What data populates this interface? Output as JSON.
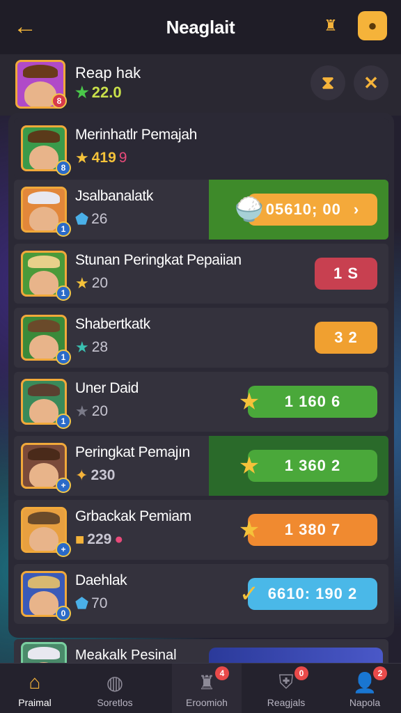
{
  "header": {
    "title": "Neaglait",
    "back_icon": "back-arrow-icon",
    "house_icon": "house-icon",
    "coin_icon": "coin-icon"
  },
  "profile": {
    "name": "Reap hak",
    "score": "22.0",
    "badge": "8",
    "action_1_icon": "hourglass-icon",
    "action_2_icon": "close-icon"
  },
  "rows": [
    {
      "name": "Merinhatlr Pemajah",
      "score": "419",
      "extra": "9",
      "rank": "8",
      "avatar_color": "#3a9a4a",
      "hair_color": "#5a3a1a",
      "star_color": "#f5c23a",
      "star": "★"
    },
    {
      "name": "Jsalbanalatk",
      "score": "26",
      "rank": "1",
      "avatar_color": "#e2873a",
      "hair_color": "#e8e8f0",
      "star_color": "#4ab0e8",
      "star": "⬟",
      "pill": "05610; 00",
      "pill_suffix": "›",
      "pill_color": "#f4a93a",
      "highlight": "#3e8a2a",
      "pill_icon": "🍚"
    },
    {
      "name": "Stunan Peringkat Pepaiian",
      "score": "20",
      "rank": "1",
      "avatar_color": "#4a9a3a",
      "hair_color": "#e8d08a",
      "star_color": "#f5c23a",
      "star": "★",
      "pill": "1 S",
      "pill_color": "#c84050"
    },
    {
      "name": "Shabertkatk",
      "score": "28",
      "rank": "1",
      "avatar_color": "#3a8a3a",
      "hair_color": "#6a4a2a",
      "star_color": "#3ac0b0",
      "star": "★",
      "pill": "3 2",
      "pill_color": "#f0a030"
    },
    {
      "name": "Uner Daid",
      "score": "20",
      "rank": "1",
      "avatar_color": "#3a8a5a",
      "hair_color": "#5a4030",
      "star_color": "#7a7a88",
      "star": "★",
      "pill": "1    160 6",
      "pill_color": "#4aa83a",
      "pill_icon": "★"
    },
    {
      "name": "Peringkat Pemajın",
      "score": "230",
      "rank": "+",
      "avatar_color": "#7a4a3a",
      "hair_color": "#4a2a1a",
      "star_color": "#f5b33a",
      "star": "✦",
      "pill": "1    360 2",
      "pill_color": "#4aa83a",
      "highlight": "#2a6a2a",
      "pill_icon": "★"
    },
    {
      "name": "Grbackak Pemiam",
      "score": "229",
      "extra": "●",
      "rank": "+",
      "avatar_color": "#e8a040",
      "hair_color": "#6a4a2a",
      "star_color": "#f5b33a",
      "star": "■",
      "pill": "1 380 7",
      "pill_color": "#f08a30",
      "pill_icon": "★"
    },
    {
      "name": "Daehlak",
      "score": "70",
      "rank": "0",
      "avatar_color": "#3a5ab8",
      "hair_color": "#d8b870",
      "star_color": "#4ab0e8",
      "star": "⬟",
      "pill": "6610: 190 2",
      "pill_color": "#4ab8e8",
      "pill_icon": "✓"
    }
  ],
  "partial_row": {
    "name": "Meakalk Pesinal"
  },
  "tabs": [
    {
      "label": "Praimal",
      "icon": "house-icon",
      "glyph": "⌂",
      "active": true
    },
    {
      "label": "Soretlos",
      "icon": "compass-icon",
      "glyph": "◍"
    },
    {
      "label": "Eroomioh",
      "icon": "castle-icon",
      "glyph": "♜",
      "badge": "4"
    },
    {
      "label": "Reagjals",
      "icon": "shield-icon",
      "glyph": "⛨",
      "badge": "0"
    },
    {
      "label": "Napola",
      "icon": "person-icon",
      "glyph": "👤",
      "badge": "2"
    }
  ]
}
